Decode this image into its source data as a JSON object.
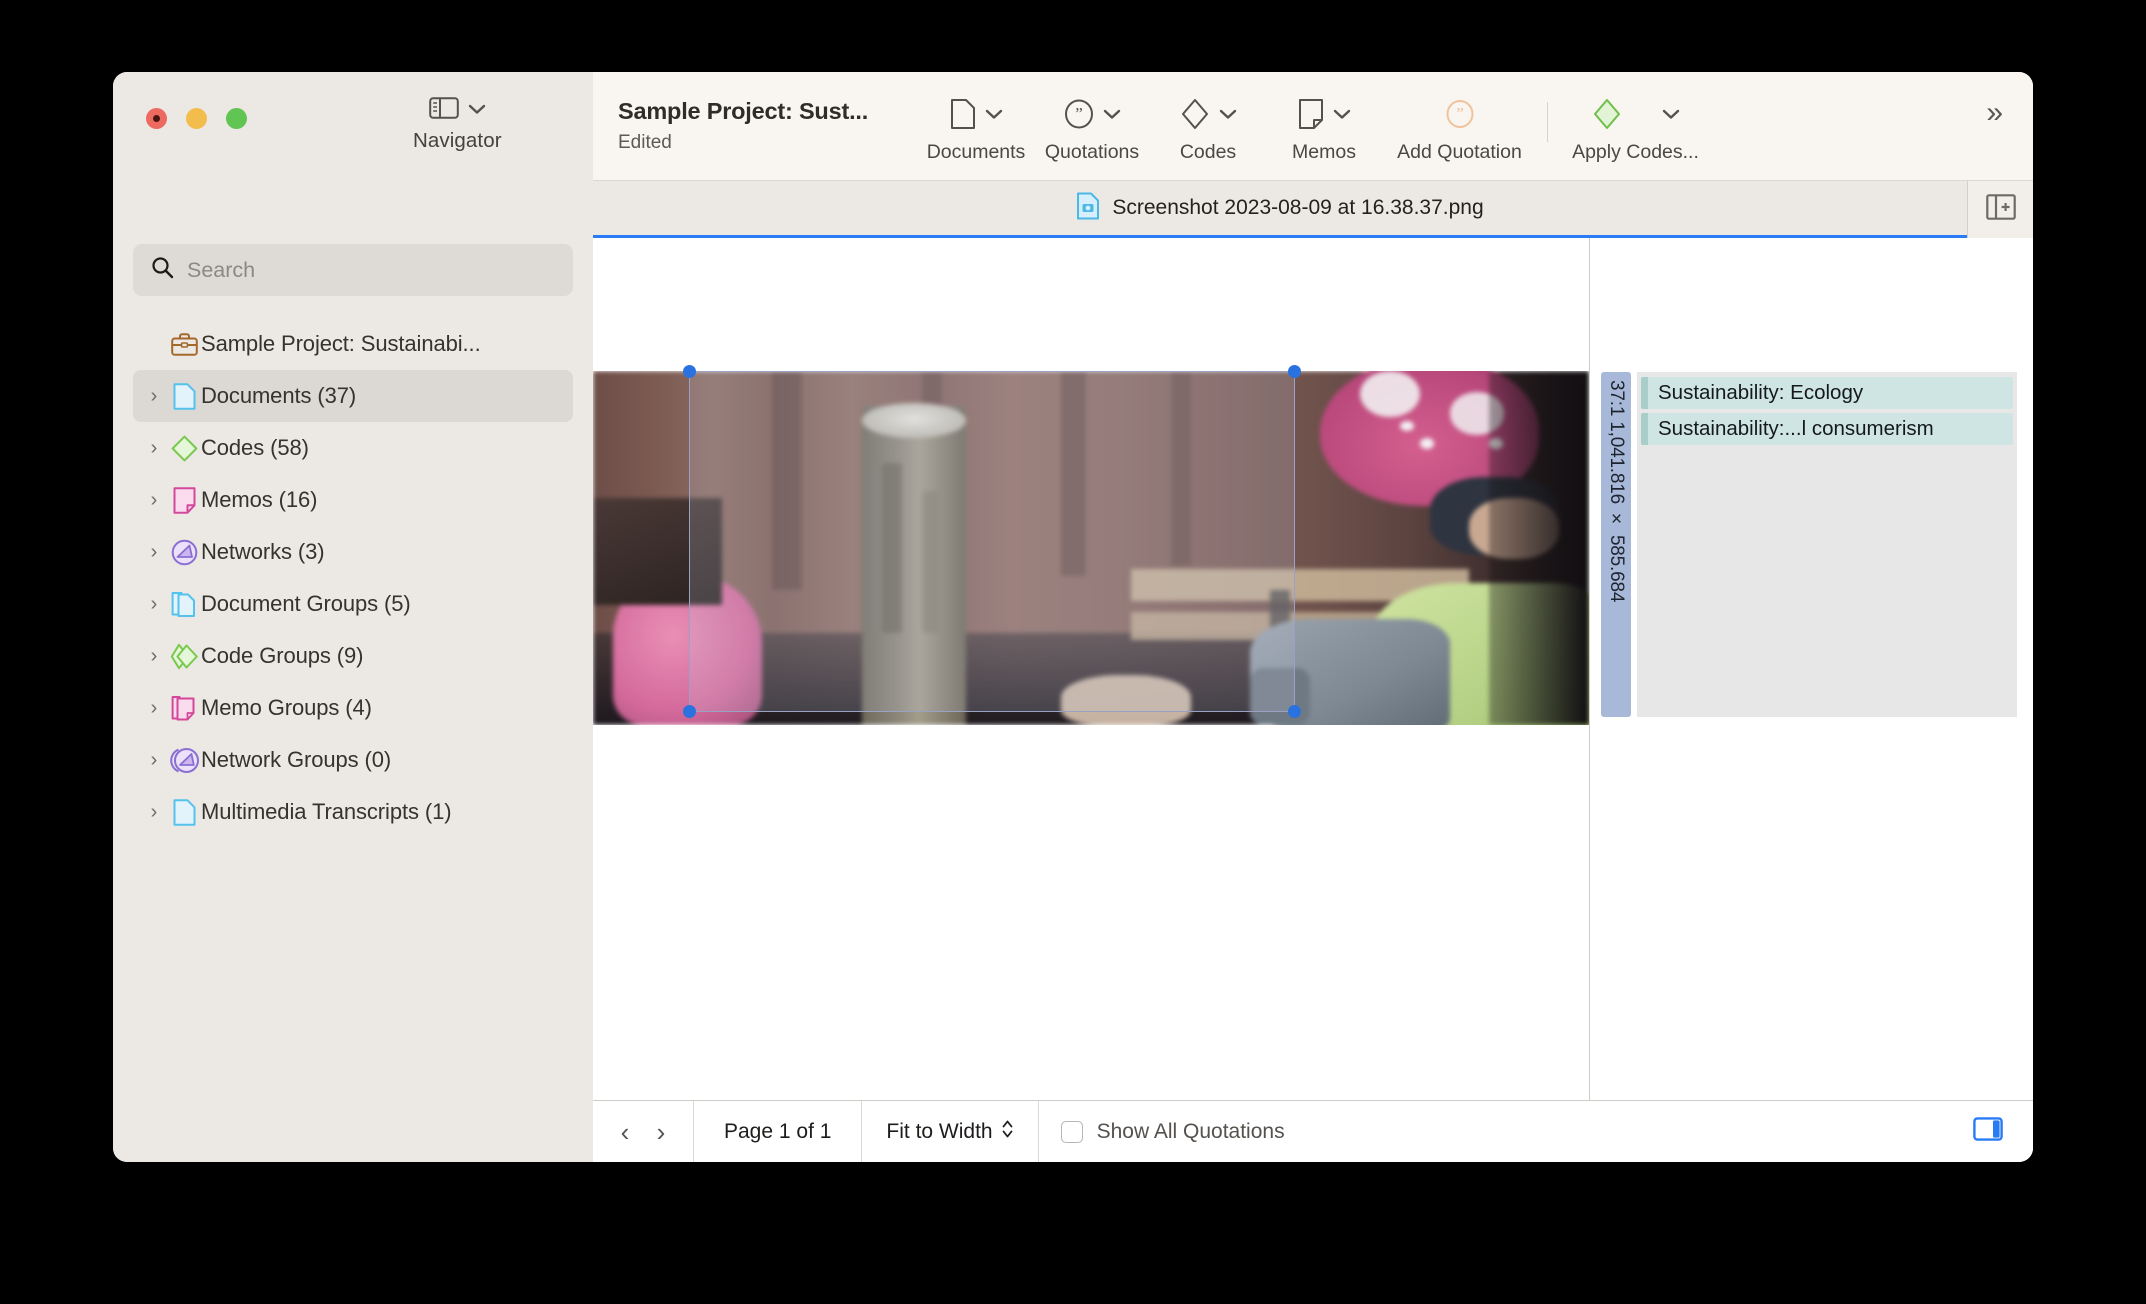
{
  "window": {
    "traffic_lights": [
      "close",
      "minimize",
      "zoom"
    ]
  },
  "sidebar_header": {
    "navigator_label": "Navigator"
  },
  "toolbar": {
    "project_title": "Sample Project: Sust...",
    "edited_status": "Edited",
    "items": [
      {
        "label": "Documents",
        "icon": "document-icon",
        "has_chevron": true
      },
      {
        "label": "Quotations",
        "icon": "quotation-icon",
        "has_chevron": true
      },
      {
        "label": "Codes",
        "icon": "code-diamond-icon",
        "has_chevron": true
      },
      {
        "label": "Memos",
        "icon": "memo-icon",
        "has_chevron": true
      },
      {
        "label": "Add Quotation",
        "icon": "add-quotation-icon",
        "has_chevron": false
      },
      {
        "label": "Apply Codes...",
        "icon": "apply-codes-icon",
        "has_chevron": true
      }
    ],
    "overflow_label": "»"
  },
  "tab": {
    "document_name": "Screenshot 2023-08-09 at 16.38.37.png",
    "icon": "image-document-icon",
    "split_view_icon": "split-view-add-icon"
  },
  "search": {
    "placeholder": "Search",
    "value": ""
  },
  "tree": {
    "root": {
      "label": "Sample Project: Sustainabi...",
      "icon": "project-briefcase-icon"
    },
    "items": [
      {
        "label": "Documents (37)",
        "icon": "document-icon",
        "selected": true
      },
      {
        "label": "Codes (58)",
        "icon": "code-diamond-icon",
        "selected": false
      },
      {
        "label": "Memos (16)",
        "icon": "memo-icon",
        "selected": false
      },
      {
        "label": "Networks (3)",
        "icon": "network-icon",
        "selected": false
      },
      {
        "label": "Document Groups (5)",
        "icon": "document-group-icon",
        "selected": false
      },
      {
        "label": "Code Groups (9)",
        "icon": "code-group-icon",
        "selected": false
      },
      {
        "label": "Memo Groups (4)",
        "icon": "memo-group-icon",
        "selected": false
      },
      {
        "label": "Network Groups (0)",
        "icon": "network-group-icon",
        "selected": false
      },
      {
        "label": "Multimedia Transcripts (1)",
        "icon": "document-icon",
        "selected": false
      }
    ]
  },
  "viewer": {
    "selection": {
      "visible": true,
      "handles": 4
    },
    "image_alt": "Child in pink knit hat and green jacket beside a cut log"
  },
  "margin": {
    "quotation_ref": "37:1 1,041.816 × 585.684",
    "codes": [
      {
        "label": "Sustainability: Ecology"
      },
      {
        "label": "Sustainability:...l consumerism"
      }
    ]
  },
  "status_bar": {
    "prev_label": "‹",
    "next_label": "›",
    "page_label": "Page 1 of 1",
    "zoom_label": "Fit to Width",
    "show_all_quotations_label": "Show All Quotations",
    "show_all_quotations_checked": false,
    "panel_toggle_icon": "right-panel-toggle-icon"
  },
  "colors": {
    "accent_blue": "#2a7bf6",
    "window_chrome": "#ece8e4",
    "toolbar_bg": "#f9f5f1",
    "code_chip": "#cfe5e3",
    "quotation_bar": "#a8b8d8",
    "code_green": "#9ed47f",
    "memo_pink": "#d64f9a",
    "network_purple": "#8a6fd1",
    "document_blue": "#6cc5ef"
  }
}
